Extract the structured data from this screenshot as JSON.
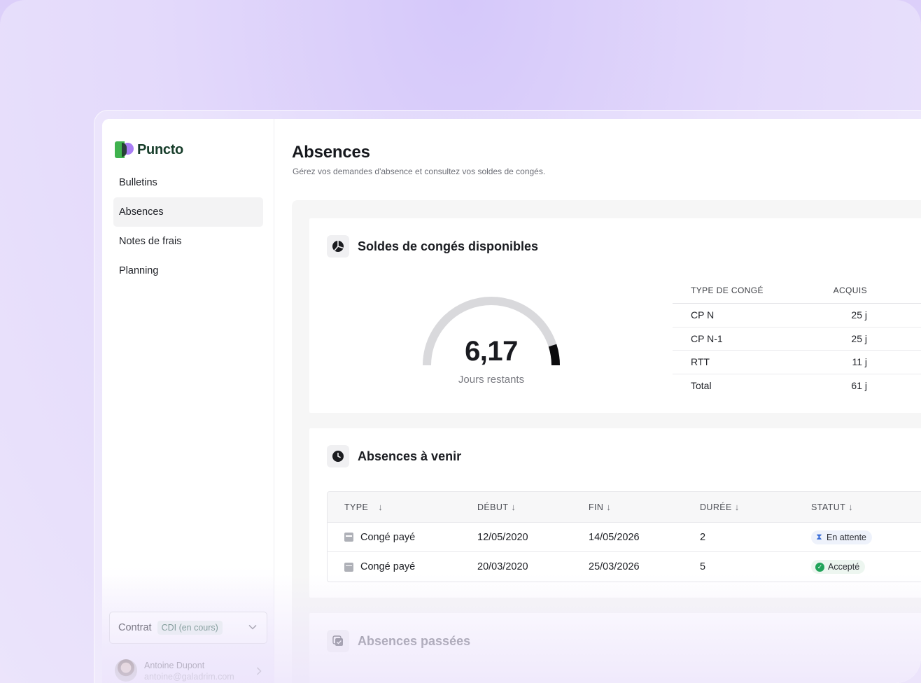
{
  "app": {
    "brand": "Puncto",
    "brand_colors": {
      "green": "#3fb24e",
      "purple": "#a97ef5",
      "dark": "#173d2a"
    }
  },
  "sidebar": {
    "items": [
      {
        "label": "Bulletins",
        "active": false
      },
      {
        "label": "Absences",
        "active": true
      },
      {
        "label": "Notes de frais",
        "active": false
      },
      {
        "label": "Planning",
        "active": false
      }
    ],
    "contract": {
      "label": "Contrat",
      "badge": "CDI (en cours)",
      "icon": "chevron-down-icon"
    },
    "user": {
      "name": "Antoine Dupont",
      "email": "antoine@galadrim.com",
      "icon": "chevron-right-icon"
    }
  },
  "page": {
    "title": "Absences",
    "subtitle": "Gérez vos demandes d'absence et consultez vos soldes de congés."
  },
  "soldes": {
    "title": "Soldes de congés disponibles",
    "icon": "pie-chart-icon",
    "gauge": {
      "value": "6,17",
      "label": "Jours restants",
      "fraction_remaining": 0.1
    },
    "headers": {
      "type": "TYPE DE CONGÉ",
      "acquis": "ACQUIS"
    },
    "rows": [
      {
        "type": "CP N",
        "acquis": "25 j"
      },
      {
        "type": "CP N-1",
        "acquis": "25 j"
      },
      {
        "type": "RTT",
        "acquis": "11 j"
      }
    ],
    "total": {
      "type": "Total",
      "acquis": "61 j"
    }
  },
  "upcoming": {
    "title": "Absences à venir",
    "icon": "clock-icon",
    "headers": {
      "type": "TYPE",
      "debut": "DÉBUT",
      "fin": "FIN",
      "duree": "DURÉE",
      "statut": "STATUT"
    },
    "rows": [
      {
        "type": "Congé payé",
        "debut": "12/05/2020",
        "fin": "14/05/2026",
        "duree": "2",
        "statut": "En attente",
        "status_icon": "hourglass-icon"
      },
      {
        "type": "Congé payé",
        "debut": "20/03/2020",
        "fin": "25/03/2026",
        "duree": "5",
        "statut": "Accepté",
        "status_icon": "check-circle-icon"
      }
    ]
  },
  "past": {
    "title": "Absences passées",
    "icon": "history-check-icon"
  }
}
